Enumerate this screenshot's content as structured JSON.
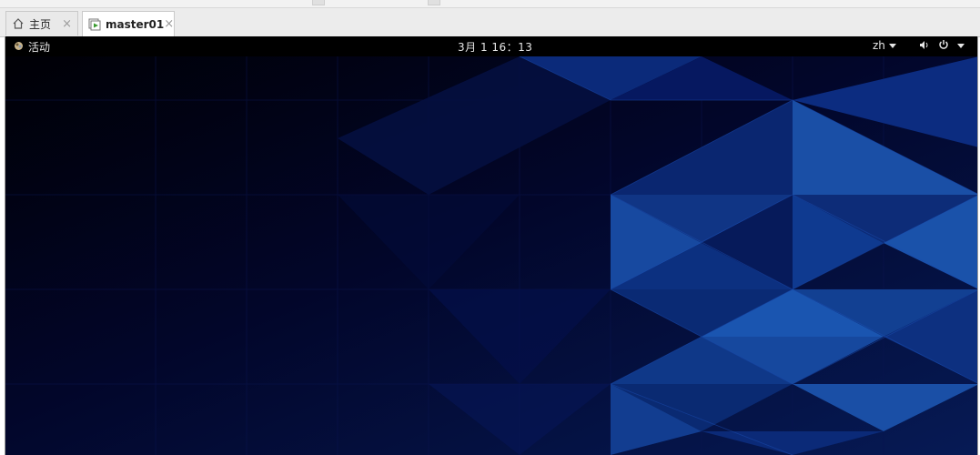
{
  "tabs": [
    {
      "label": "主页",
      "icon": "home-icon",
      "close": "×"
    },
    {
      "label": "master01",
      "icon": "vm-icon",
      "close": "×"
    }
  ],
  "gnome": {
    "activities": "活动",
    "clock": "3月 1  16：13",
    "lang": "zh"
  },
  "colors": {
    "topbar": "#000000",
    "desktop_dark": "#01041c",
    "desktop_blue": "#0a3a8a",
    "desktop_bright": "#1a55b0"
  }
}
